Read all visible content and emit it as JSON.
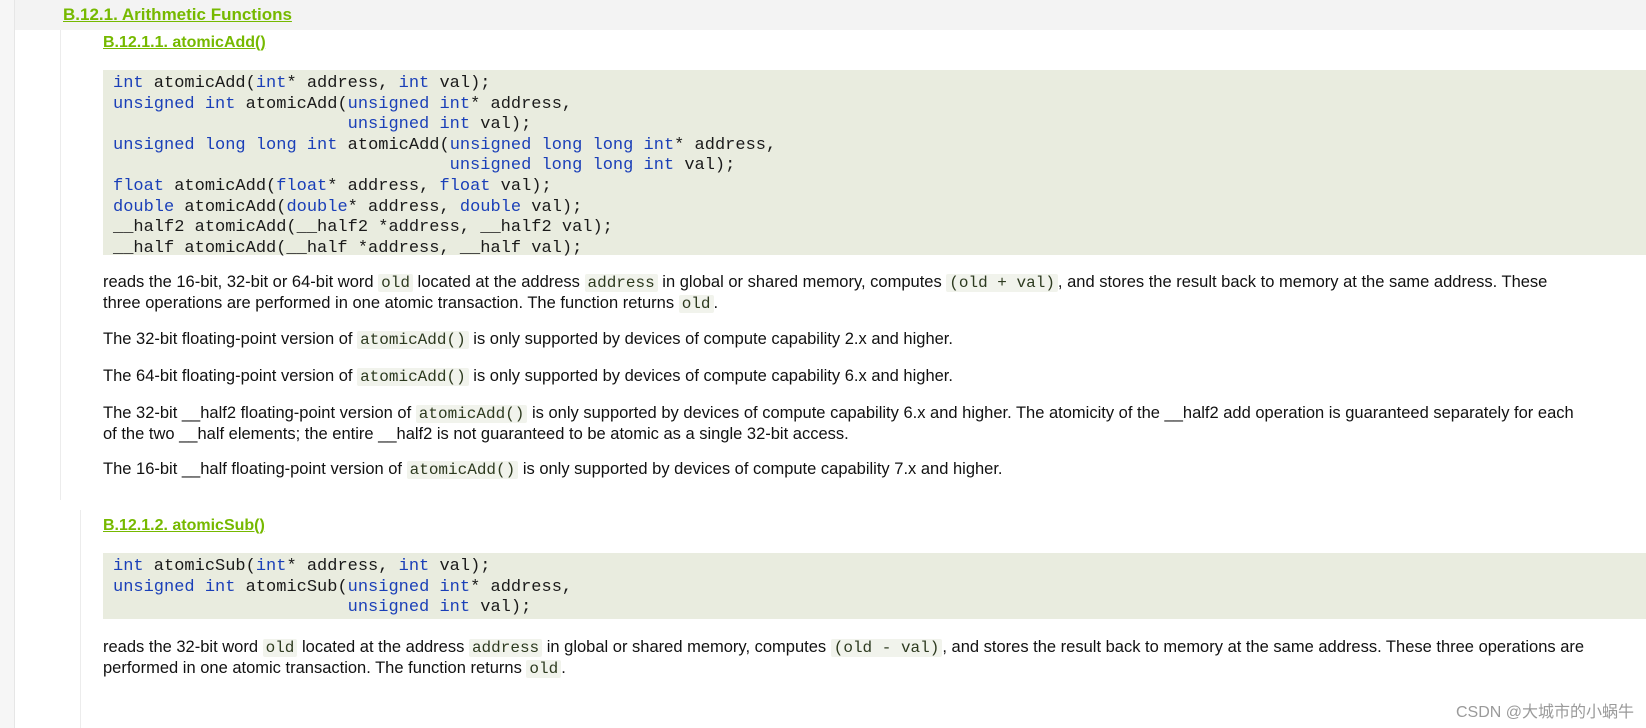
{
  "section": {
    "heading": "B.12.1. Arithmetic Functions"
  },
  "atomicAdd": {
    "heading": "B.12.1.1. atomicAdd()",
    "code": [
      [
        [
          "kw",
          "int"
        ],
        [
          "t",
          " atomicAdd("
        ],
        [
          "kw",
          "int"
        ],
        [
          "t",
          "* address, "
        ],
        [
          "kw",
          "int"
        ],
        [
          "t",
          " val);"
        ]
      ],
      [
        [
          "kw",
          "unsigned"
        ],
        [
          "t",
          " "
        ],
        [
          "kw",
          "int"
        ],
        [
          "t",
          " atomicAdd("
        ],
        [
          "kw",
          "unsigned"
        ],
        [
          "t",
          " "
        ],
        [
          "kw",
          "int"
        ],
        [
          "t",
          "* address,"
        ]
      ],
      [
        [
          "t",
          "                       "
        ],
        [
          "kw",
          "unsigned"
        ],
        [
          "t",
          " "
        ],
        [
          "kw",
          "int"
        ],
        [
          "t",
          " val);"
        ]
      ],
      [
        [
          "kw",
          "unsigned"
        ],
        [
          "t",
          " "
        ],
        [
          "kw",
          "long"
        ],
        [
          "t",
          " "
        ],
        [
          "kw",
          "long"
        ],
        [
          "t",
          " "
        ],
        [
          "kw",
          "int"
        ],
        [
          "t",
          " atomicAdd("
        ],
        [
          "kw",
          "unsigned"
        ],
        [
          "t",
          " "
        ],
        [
          "kw",
          "long"
        ],
        [
          "t",
          " "
        ],
        [
          "kw",
          "long"
        ],
        [
          "t",
          " "
        ],
        [
          "kw",
          "int"
        ],
        [
          "t",
          "* address,"
        ]
      ],
      [
        [
          "t",
          "                                 "
        ],
        [
          "kw",
          "unsigned"
        ],
        [
          "t",
          " "
        ],
        [
          "kw",
          "long"
        ],
        [
          "t",
          " "
        ],
        [
          "kw",
          "long"
        ],
        [
          "t",
          " "
        ],
        [
          "kw",
          "int"
        ],
        [
          "t",
          " val);"
        ]
      ],
      [
        [
          "kw",
          "float"
        ],
        [
          "t",
          " atomicAdd("
        ],
        [
          "kw",
          "float"
        ],
        [
          "t",
          "* address, "
        ],
        [
          "kw",
          "float"
        ],
        [
          "t",
          " val);"
        ]
      ],
      [
        [
          "kw",
          "double"
        ],
        [
          "t",
          " atomicAdd("
        ],
        [
          "kw",
          "double"
        ],
        [
          "t",
          "* address, "
        ],
        [
          "kw",
          "double"
        ],
        [
          "t",
          " val);"
        ]
      ],
      [
        [
          "t",
          "__half2 atomicAdd(__half2 *address, __half2 val);"
        ]
      ],
      [
        [
          "t",
          "__half atomicAdd(__half *address, __half val);"
        ]
      ]
    ],
    "paragraphs": [
      [
        [
          [
            "t",
            "reads the 16-bit, 32-bit or 64-bit word "
          ],
          [
            "c",
            "old"
          ],
          [
            "t",
            " located at the address "
          ],
          [
            "c",
            "address"
          ],
          [
            "t",
            " in global or shared memory, computes "
          ],
          [
            "c",
            "(old + val)"
          ],
          [
            "t",
            ", and stores the result back to memory at the same address. These"
          ]
        ],
        [
          [
            "t",
            "three operations are performed in one atomic transaction. The function returns "
          ],
          [
            "c",
            "old"
          ],
          [
            "t",
            "."
          ]
        ]
      ],
      [
        [
          [
            "t",
            "The 32-bit floating-point version of "
          ],
          [
            "c",
            "atomicAdd()"
          ],
          [
            "t",
            " is only supported by devices of compute capability 2.x and higher."
          ]
        ]
      ],
      [
        [
          [
            "t",
            "The 64-bit floating-point version of "
          ],
          [
            "c",
            "atomicAdd()"
          ],
          [
            "t",
            " is only supported by devices of compute capability 6.x and higher."
          ]
        ]
      ],
      [
        [
          [
            "t",
            "The 32-bit __half2 floating-point version of "
          ],
          [
            "c",
            "atomicAdd()"
          ],
          [
            "t",
            " is only supported by devices of compute capability 6.x and higher. The atomicity of the __half2 add operation is guaranteed separately for each"
          ]
        ],
        [
          [
            "t",
            "of the two __half elements; the entire __half2 is not guaranteed to be atomic as a single 32-bit access."
          ]
        ]
      ],
      [
        [
          [
            "t",
            "The 16-bit __half floating-point version of "
          ],
          [
            "c",
            "atomicAdd()"
          ],
          [
            "t",
            " is only supported by devices of compute capability 7.x and higher."
          ]
        ]
      ]
    ]
  },
  "atomicSub": {
    "heading": "B.12.1.2. atomicSub()",
    "code": [
      [
        [
          "kw",
          "int"
        ],
        [
          "t",
          " atomicSub("
        ],
        [
          "kw",
          "int"
        ],
        [
          "t",
          "* address, "
        ],
        [
          "kw",
          "int"
        ],
        [
          "t",
          " val);"
        ]
      ],
      [
        [
          "kw",
          "unsigned"
        ],
        [
          "t",
          " "
        ],
        [
          "kw",
          "int"
        ],
        [
          "t",
          " atomicSub("
        ],
        [
          "kw",
          "unsigned"
        ],
        [
          "t",
          " "
        ],
        [
          "kw",
          "int"
        ],
        [
          "t",
          "* address,"
        ]
      ],
      [
        [
          "t",
          "                       "
        ],
        [
          "kw",
          "unsigned"
        ],
        [
          "t",
          " "
        ],
        [
          "kw",
          "int"
        ],
        [
          "t",
          " val);"
        ]
      ]
    ],
    "paragraphs": [
      [
        [
          [
            "t",
            "reads the 32-bit word "
          ],
          [
            "c",
            "old"
          ],
          [
            "t",
            " located at the address "
          ],
          [
            "c",
            "address"
          ],
          [
            "t",
            " in global or shared memory, computes "
          ],
          [
            "c",
            "(old - val)"
          ],
          [
            "t",
            ", and stores the result back to memory at the same address. These three operations are"
          ]
        ],
        [
          [
            "t",
            "performed in one atomic transaction. The function returns "
          ],
          [
            "c",
            "old"
          ],
          [
            "t",
            "."
          ]
        ]
      ]
    ]
  },
  "watermark": "CSDN @大城市的小蜗牛",
  "colors": {
    "heading": "#76b900",
    "keyword": "#1a3fb8",
    "code_background": "#e9ecdf"
  }
}
